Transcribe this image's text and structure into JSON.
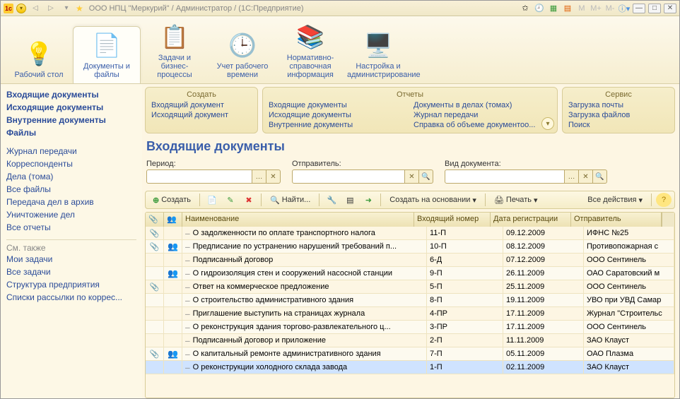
{
  "titlebar": {
    "title": "ООО НПЦ \"Меркурий\" / Администратор /  (1С:Предприятие)"
  },
  "sections": [
    {
      "label": "Рабочий стол",
      "icon": "💡"
    },
    {
      "label": "Документы и файлы",
      "icon": "📄",
      "active": true
    },
    {
      "label": "Задачи и бизнес-процессы",
      "icon": "📋"
    },
    {
      "label": "Учет рабочего времени",
      "icon": "🕒"
    },
    {
      "label": "Нормативно-справочная информация",
      "icon": "📚"
    },
    {
      "label": "Настройка и администрирование",
      "icon": "🖥️"
    }
  ],
  "left_nav": {
    "primary": [
      "Входящие документы",
      "Исходящие документы",
      "Внутренние документы",
      "Файлы"
    ],
    "secondary": [
      "Журнал передачи",
      "Корреспонденты",
      "Дела (тома)",
      "Все файлы",
      "Передача дел в архив",
      "Уничтожение дел",
      "Все отчеты"
    ],
    "see_also_head": "См.  также",
    "see_also": [
      "Мои задачи",
      "Все задачи",
      "Структура предприятия",
      "Списки рассылки по коррес..."
    ]
  },
  "panels": {
    "create": {
      "title": "Создать",
      "items": [
        "Входящий документ",
        "Исходящий документ"
      ]
    },
    "reports": {
      "title": "Отчеты",
      "col1": [
        "Входящие документы",
        "Исходящие документы",
        "Внутренние документы"
      ],
      "col2": [
        "Документы в делах (томах)",
        "Журнал передачи",
        "Справка об объеме документоо..."
      ]
    },
    "service": {
      "title": "Сервис",
      "items": [
        "Загрузка почты",
        "Загрузка файлов",
        "Поиск"
      ]
    }
  },
  "main": {
    "title": "Входящие документы",
    "filters": {
      "period_label": "Период:",
      "sender_label": "Отправитель:",
      "doctype_label": "Вид документа:"
    },
    "toolbar": {
      "create": "Создать",
      "find": "Найти...",
      "create_based": "Создать на основании",
      "print": "Печать",
      "all_actions": "Все действия"
    },
    "columns": {
      "name": "Наименование",
      "num": "Входящий номер",
      "date": "Дата регистрации",
      "sender": "Отправитель"
    },
    "rows": [
      {
        "clip": true,
        "user": false,
        "name": "О задолженности по оплате транспортного налога",
        "num": "11-П",
        "date": "09.12.2009",
        "sender": "ИФНС №25"
      },
      {
        "clip": true,
        "user": true,
        "name": "Предписание по устранению нарушений требований п...",
        "num": "10-П",
        "date": "08.12.2009",
        "sender": "Противопожарная с"
      },
      {
        "clip": false,
        "user": false,
        "name": "Подписанный договор",
        "num": "6-Д",
        "date": "07.12.2009",
        "sender": "ООО Сентинель"
      },
      {
        "clip": false,
        "user": true,
        "name": "О гидроизоляция стен и сооружений насосной станции",
        "num": "9-П",
        "date": "26.11.2009",
        "sender": "ОАО Саратовский м"
      },
      {
        "clip": true,
        "user": false,
        "name": "Ответ на коммерческое предложение",
        "num": "5-П",
        "date": "25.11.2009",
        "sender": "ООО Сентинель"
      },
      {
        "clip": false,
        "user": false,
        "name": "О строительство административного здания",
        "num": "8-П",
        "date": "19.11.2009",
        "sender": "УВО при УВД Самар"
      },
      {
        "clip": false,
        "user": false,
        "name": "Приглашение выступить на страницах журнала",
        "num": "4-ПР",
        "date": "17.11.2009",
        "sender": "Журнал \"Строительс"
      },
      {
        "clip": false,
        "user": false,
        "name": "О реконструкция здания торгово-развлекательного ц...",
        "num": "3-ПР",
        "date": "17.11.2009",
        "sender": "ООО Сентинель"
      },
      {
        "clip": false,
        "user": false,
        "name": "Подписанный договор и приложение",
        "num": "2-П",
        "date": "11.11.2009",
        "sender": "ЗАО Клауст"
      },
      {
        "clip": true,
        "user": true,
        "name": "О капитальный ремонте административного здания",
        "num": "7-П",
        "date": "05.11.2009",
        "sender": "ОАО Плазма"
      },
      {
        "clip": false,
        "user": false,
        "name": "О реконструкции холодного склада завода",
        "num": "1-П",
        "date": "02.11.2009",
        "sender": "ЗАО Клауст",
        "selected": true
      }
    ]
  }
}
